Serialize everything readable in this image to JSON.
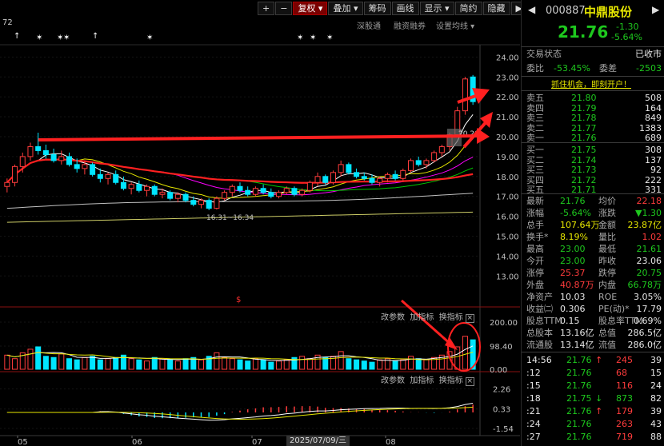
{
  "toolbar": {
    "buttons": [
      "+",
      "−",
      "复权",
      "叠加",
      "筹码",
      "画线",
      "显示",
      "简约",
      "隐藏"
    ],
    "right_arrows": "▶▶"
  },
  "topleft_value": "72",
  "sub_toolbar": {
    "deep_data": "深股通",
    "margin": "融资融券",
    "settings": "设置均线"
  },
  "indicator_bar": {
    "change_params": "改参数",
    "add_indicator": "加指标",
    "switch_indicator": "换指标",
    "close": "×"
  },
  "price_axis": [
    "24.00",
    "23.00",
    "22.00",
    "21.00",
    "20.00",
    "19.00",
    "18.00",
    "17.00",
    "16.00",
    "15.00",
    "14.00",
    "13.00"
  ],
  "volume_axis": [
    "200.00",
    "98.40",
    "0.00"
  ],
  "macd_axis": [
    "2.26",
    "0.33",
    "-1.54"
  ],
  "x_labels": [
    "05",
    "06",
    "07",
    "08"
  ],
  "date_cursor": "2025/07/09/三",
  "annotations": {
    "low_range": "16.31~16.34",
    "peak_label": "20.20"
  },
  "chart_data": {
    "type": "candlestick",
    "candles": [
      [
        17.5,
        17.9,
        17.2,
        17.7
      ],
      [
        17.7,
        18.6,
        17.5,
        18.5
      ],
      [
        18.5,
        19.2,
        18.2,
        19.0
      ],
      [
        19.0,
        19.7,
        18.8,
        19.5
      ],
      [
        19.5,
        20.2,
        19.1,
        19.3
      ],
      [
        19.3,
        19.6,
        18.9,
        19.1
      ],
      [
        19.1,
        19.4,
        18.7,
        18.8
      ],
      [
        18.8,
        19.3,
        18.6,
        19.0
      ],
      [
        19.0,
        19.2,
        18.5,
        18.6
      ],
      [
        18.6,
        18.9,
        18.2,
        18.4
      ],
      [
        18.4,
        18.8,
        18.1,
        18.6
      ],
      [
        18.6,
        18.7,
        18.0,
        18.1
      ],
      [
        18.1,
        18.4,
        17.7,
        17.9
      ],
      [
        17.9,
        18.2,
        17.6,
        18.1
      ],
      [
        18.1,
        18.3,
        17.6,
        17.7
      ],
      [
        17.7,
        18.0,
        17.3,
        17.4
      ],
      [
        17.4,
        17.7,
        17.1,
        17.6
      ],
      [
        17.6,
        17.8,
        17.2,
        17.3
      ],
      [
        17.3,
        17.6,
        17.0,
        17.5
      ],
      [
        17.5,
        17.6,
        17.0,
        17.1
      ],
      [
        17.1,
        17.4,
        16.9,
        17.2
      ],
      [
        17.2,
        17.3,
        16.8,
        16.9
      ],
      [
        16.9,
        17.2,
        16.7,
        17.1
      ],
      [
        17.1,
        17.2,
        16.7,
        16.8
      ],
      [
        16.8,
        17.0,
        16.5,
        16.6
      ],
      [
        16.6,
        16.9,
        16.4,
        16.8
      ],
      [
        16.8,
        16.9,
        16.31,
        16.4
      ],
      [
        16.4,
        17.0,
        16.34,
        16.9
      ],
      [
        16.9,
        17.3,
        16.8,
        17.2
      ],
      [
        17.2,
        17.6,
        17.0,
        17.5
      ],
      [
        17.5,
        17.7,
        17.2,
        17.3
      ],
      [
        17.3,
        17.5,
        17.0,
        17.1
      ],
      [
        17.1,
        17.5,
        17.0,
        17.4
      ],
      [
        17.4,
        17.6,
        17.1,
        17.2
      ],
      [
        17.2,
        17.4,
        16.9,
        17.0
      ],
      [
        17.0,
        17.3,
        16.9,
        17.2
      ],
      [
        17.2,
        17.5,
        17.1,
        17.4
      ],
      [
        17.4,
        17.5,
        17.0,
        17.1
      ],
      [
        17.1,
        17.4,
        17.0,
        17.3
      ],
      [
        17.3,
        17.8,
        17.2,
        17.7
      ],
      [
        17.7,
        18.2,
        17.5,
        18.0
      ],
      [
        18.0,
        18.1,
        17.6,
        17.7
      ],
      [
        17.7,
        18.3,
        17.6,
        18.2
      ],
      [
        18.2,
        18.8,
        18.0,
        18.6
      ],
      [
        18.6,
        18.7,
        18.1,
        18.2
      ],
      [
        18.2,
        18.4,
        17.9,
        18.0
      ],
      [
        18.0,
        18.2,
        17.8,
        17.9
      ],
      [
        17.9,
        18.1,
        17.6,
        17.7
      ],
      [
        17.7,
        18.0,
        17.5,
        17.9
      ],
      [
        17.9,
        18.2,
        17.7,
        18.1
      ],
      [
        18.1,
        18.3,
        17.8,
        17.9
      ],
      [
        17.9,
        18.4,
        17.8,
        18.3
      ],
      [
        18.3,
        18.9,
        18.2,
        18.8
      ],
      [
        18.8,
        19.0,
        18.5,
        18.6
      ],
      [
        18.6,
        18.9,
        18.4,
        18.8
      ],
      [
        18.8,
        19.3,
        18.7,
        19.2
      ],
      [
        19.2,
        19.6,
        19.0,
        19.5
      ],
      [
        19.5,
        20.2,
        19.3,
        20.1
      ],
      [
        20.1,
        21.5,
        20.0,
        21.3
      ],
      [
        21.3,
        23.0,
        21.1,
        22.9
      ],
      [
        23.0,
        23.1,
        21.6,
        21.76
      ]
    ],
    "volume": [
      60,
      45,
      70,
      85,
      95,
      55,
      50,
      65,
      45,
      40,
      50,
      55,
      40,
      45,
      50,
      60,
      45,
      40,
      35,
      50,
      45,
      40,
      35,
      45,
      50,
      40,
      55,
      70,
      50,
      45,
      40,
      35,
      45,
      40,
      30,
      35,
      40,
      50,
      55,
      45,
      60,
      50,
      55,
      75,
      45,
      40,
      35,
      30,
      40,
      45,
      35,
      40,
      55,
      45,
      40,
      50,
      60,
      75,
      95,
      140,
      125
    ],
    "ma_colors": {
      "ma5": "#ffffff",
      "ma10": "#e6e600",
      "ma20": "#ff00ff",
      "ma30": "#00c800",
      "ma60": "#ff2020",
      "ma120": "#c0c0c0",
      "ma250": "#cccc66"
    }
  },
  "header": {
    "code": "000887",
    "name": "中鼎股份",
    "price": "21.76",
    "change": "-1.30",
    "change_pct": "-5.64%"
  },
  "trade_status": {
    "label": "交易状态",
    "value": "已收市"
  },
  "weibi": {
    "label": "委比",
    "value": "-53.45%",
    "label2": "委差",
    "value2": "-2503"
  },
  "promo": "抓住机会，即刻开户！",
  "asks": [
    {
      "label": "卖五",
      "price": "21.80",
      "vol": "508"
    },
    {
      "label": "卖四",
      "price": "21.79",
      "vol": "164"
    },
    {
      "label": "卖三",
      "price": "21.78",
      "vol": "849"
    },
    {
      "label": "卖二",
      "price": "21.77",
      "vol": "1383"
    },
    {
      "label": "卖一",
      "price": "21.76",
      "vol": "689"
    }
  ],
  "bids": [
    {
      "label": "买一",
      "price": "21.75",
      "vol": "308"
    },
    {
      "label": "买二",
      "price": "21.74",
      "vol": "137"
    },
    {
      "label": "买三",
      "price": "21.73",
      "vol": "92"
    },
    {
      "label": "买四",
      "price": "21.72",
      "vol": "222"
    },
    {
      "label": "买五",
      "price": "21.71",
      "vol": "331"
    }
  ],
  "stats": [
    {
      "l1": "最新",
      "v1": "21.76",
      "c1": "green",
      "l2": "均价",
      "v2": "22.18",
      "c2": "red"
    },
    {
      "l1": "涨幅",
      "v1": "-5.64%",
      "c1": "green",
      "l2": "涨跌",
      "v2": "▼1.30",
      "c2": "green"
    },
    {
      "l1": "总手",
      "v1": "107.64万",
      "c1": "yellow",
      "l2": "金额",
      "v2": "23.87亿",
      "c2": "yellow"
    },
    {
      "l1": "换手*",
      "v1": "8.19%",
      "c1": "yellow",
      "l2": "量比",
      "v2": "1.02",
      "c2": "red"
    },
    {
      "l1": "最高",
      "v1": "23.00",
      "c1": "green",
      "l2": "最低",
      "v2": "21.61",
      "c2": "green"
    },
    {
      "l1": "今开",
      "v1": "23.00",
      "c1": "green",
      "l2": "昨收",
      "v2": "23.06",
      "c2": "white"
    },
    {
      "l1": "涨停",
      "v1": "25.37",
      "c1": "red",
      "l2": "跌停",
      "v2": "20.75",
      "c2": "green"
    },
    {
      "l1": "外盘",
      "v1": "40.87万",
      "c1": "red",
      "l2": "内盘",
      "v2": "66.78万",
      "c2": "green"
    },
    {
      "l1": "净资产",
      "v1": "10.03",
      "c1": "white",
      "l2": "ROE",
      "v2": "3.05%",
      "c2": "white"
    },
    {
      "l1": "收益㈡",
      "v1": "0.306",
      "c1": "white",
      "l2": "PE(动)*",
      "v2": "17.79",
      "c2": "white"
    },
    {
      "l1": "股息TTM",
      "v1": "0.15",
      "c1": "white",
      "l2": "股息率TTM",
      "v2": "0.69%",
      "c2": "white"
    },
    {
      "l1": "总股本",
      "v1": "13.16亿",
      "c1": "white",
      "l2": "总值",
      "v2": "286.5亿",
      "c2": "white"
    },
    {
      "l1": "流通股",
      "v1": "13.14亿",
      "c1": "white",
      "l2": "流值",
      "v2": "286.0亿",
      "c2": "white"
    }
  ],
  "ticks": [
    {
      "time": "14:56",
      "price": "21.76",
      "arrow": "↑",
      "arrow_color": "red",
      "vol": "245",
      "vol_color": "red",
      "n": "39"
    },
    {
      "time": ":12",
      "price": "21.76",
      "arrow": "",
      "arrow_color": "",
      "vol": "68",
      "vol_color": "red",
      "n": "15"
    },
    {
      "time": ":15",
      "price": "21.76",
      "arrow": "",
      "arrow_color": "",
      "vol": "116",
      "vol_color": "red",
      "n": "24"
    },
    {
      "time": ":18",
      "price": "21.75",
      "arrow": "↓",
      "arrow_color": "green",
      "vol": "873",
      "vol_color": "green",
      "n": "82"
    },
    {
      "time": ":21",
      "price": "21.76",
      "arrow": "↑",
      "arrow_color": "red",
      "vol": "179",
      "vol_color": "red",
      "n": "39"
    },
    {
      "time": ":24",
      "price": "21.76",
      "arrow": "",
      "arrow_color": "",
      "vol": "263",
      "vol_color": "red",
      "n": "43"
    },
    {
      "time": ":27",
      "price": "21.76",
      "arrow": "",
      "arrow_color": "",
      "vol": "719",
      "vol_color": "red",
      "n": "88"
    }
  ]
}
